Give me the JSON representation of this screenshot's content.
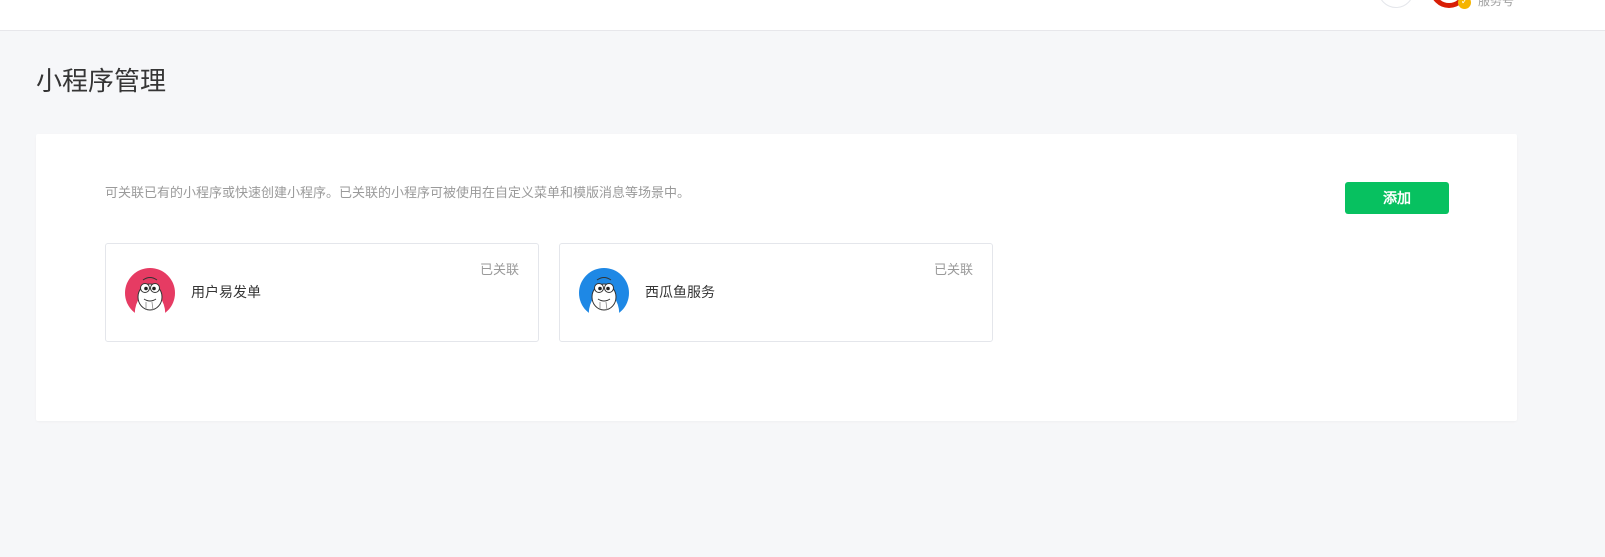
{
  "topbar": {
    "account_type": "服务号",
    "avatar_color": "#d81e06",
    "verified_color": "#f5b400"
  },
  "page": {
    "title": "小程序管理"
  },
  "panel": {
    "description": "可关联已有的小程序或快速创建小程序。已关联的小程序可被使用在自定义菜单和模版消息等场景中。",
    "add_label": "添加",
    "add_color": "#07c160",
    "mini_programs": [
      {
        "name": "用户易发单",
        "status": "已关联",
        "avatar_color": "#e63b63",
        "avatar_icon": "cartoon-character-icon"
      },
      {
        "name": "西瓜鱼服务",
        "status": "已关联",
        "avatar_color": "#1e88e5",
        "avatar_icon": "cartoon-character-icon"
      }
    ]
  }
}
